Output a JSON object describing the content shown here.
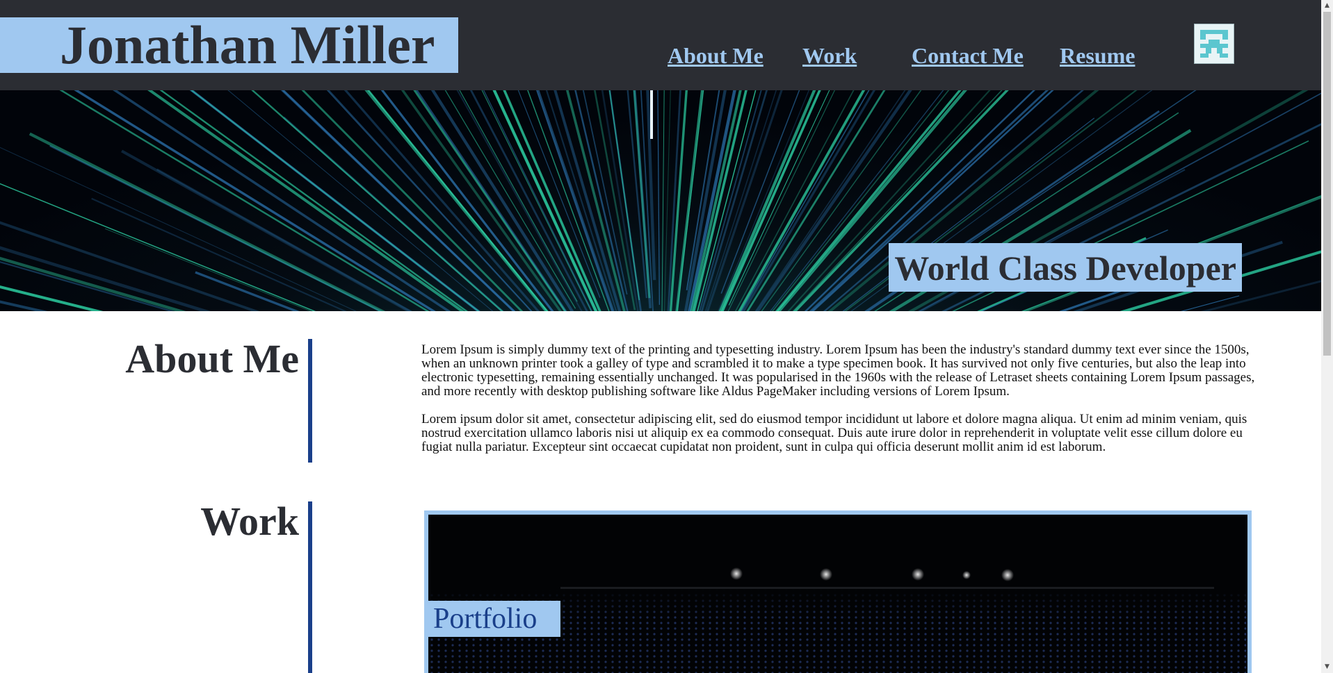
{
  "site": {
    "brand": "Jonathan Miller",
    "nav": [
      {
        "label": "About Me"
      },
      {
        "label": "Work"
      },
      {
        "label": "Contact Me"
      },
      {
        "label": "Resume"
      }
    ],
    "avatar_icon": "pixel-avatar-icon"
  },
  "hero": {
    "tagline": "World Class Developer"
  },
  "about": {
    "title": "About Me",
    "paragraphs": [
      "Lorem Ipsum is simply dummy text of the printing and typesetting industry. Lorem Ipsum has been the industry's standard dummy text ever since the 1500s, when an unknown printer took a galley of type and scrambled it to make a type specimen book. It has survived not only five centuries, but also the leap into electronic typesetting, remaining essentially unchanged. It was popularised in the 1960s with the release of Letraset sheets containing Lorem Ipsum passages, and more recently with desktop publishing software like Aldus PageMaker including versions of Lorem Ipsum.",
      "Lorem ipsum dolor sit amet, consectetur adipiscing elit, sed do eiusmod tempor incididunt ut labore et dolore magna aliqua. Ut enim ad minim veniam, quis nostrud exercitation ullamco laboris nisi ut aliquip ex ea commodo consequat. Duis aute irure dolor in reprehenderit in voluptate velit esse cillum dolore eu fugiat nulla pariatur. Excepteur sint occaecat cupidatat non proident, sunt in culpa qui officia deserunt mollit anim id est laborum."
    ]
  },
  "work": {
    "title": "Work",
    "cards": [
      {
        "label": "Portfolio"
      }
    ]
  },
  "colors": {
    "header_bg": "#2b2d33",
    "accent_light": "#a0c8f0",
    "accent_dark": "#1a3f8a",
    "hero_teal": "#2ed6a8",
    "hero_blue": "#2a6fa8"
  }
}
